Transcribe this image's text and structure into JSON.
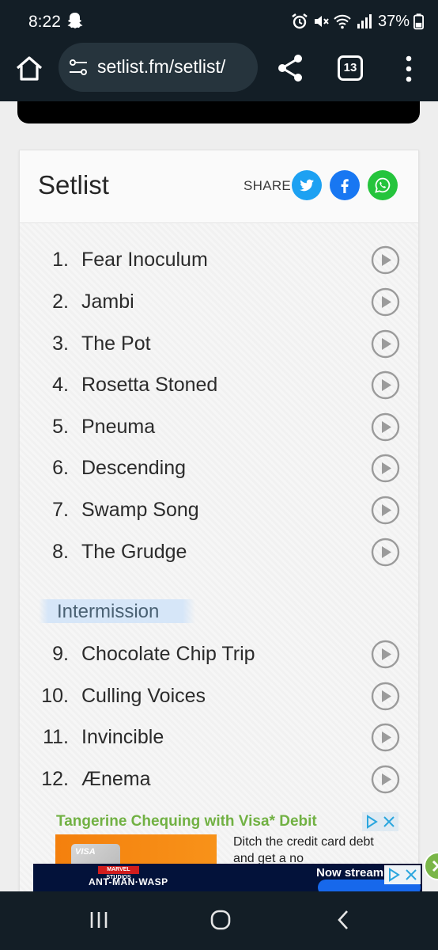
{
  "status_bar": {
    "time": "8:22",
    "battery": "37%",
    "icons": [
      "snapchat-ghost-icon",
      "alarm-icon",
      "mute-icon",
      "wifi-icon",
      "signal-icon",
      "battery-icon"
    ]
  },
  "browser": {
    "url": "setlist.fm/setlist/",
    "tab_count": "13",
    "icons": [
      "home-icon",
      "site-settings-icon",
      "share-icon",
      "tabs-icon",
      "more-menu-icon"
    ]
  },
  "setlist": {
    "title": "Setlist",
    "share_label": "SHARE",
    "share_buttons": [
      "twitter",
      "facebook",
      "whatsapp"
    ],
    "share_colors": {
      "twitter": "#1da1f2",
      "facebook": "#1877f2",
      "whatsapp": "#25c43c"
    },
    "songs_main": [
      {
        "num": "1.",
        "title": "Fear Inoculum"
      },
      {
        "num": "2.",
        "title": "Jambi"
      },
      {
        "num": "3.",
        "title": "The Pot"
      },
      {
        "num": "4.",
        "title": "Rosetta Stoned"
      },
      {
        "num": "5.",
        "title": "Pneuma"
      },
      {
        "num": "6.",
        "title": "Descending"
      },
      {
        "num": "7.",
        "title": "Swamp Song"
      },
      {
        "num": "8.",
        "title": "The Grudge"
      }
    ],
    "intermission_label": "Intermission",
    "songs_after": [
      {
        "num": "9.",
        "title": "Chocolate Chip Trip"
      },
      {
        "num": "10.",
        "title": "Culling Voices"
      },
      {
        "num": "11.",
        "title": "Invincible"
      },
      {
        "num": "12.",
        "title": "Ænema"
      }
    ]
  },
  "ad": {
    "headline": "Tangerine Chequing with Visa* Debit",
    "body": "Ditch the credit card debt and get a no",
    "card_brand": "VISA"
  },
  "banner_ad": {
    "brand": "MARVEL STUDIOS",
    "title": "ANT-MAN·WASP",
    "cta": "Now stream"
  },
  "nav_bar": {
    "icons": [
      "recents-icon",
      "home-circle-icon",
      "back-icon"
    ]
  }
}
